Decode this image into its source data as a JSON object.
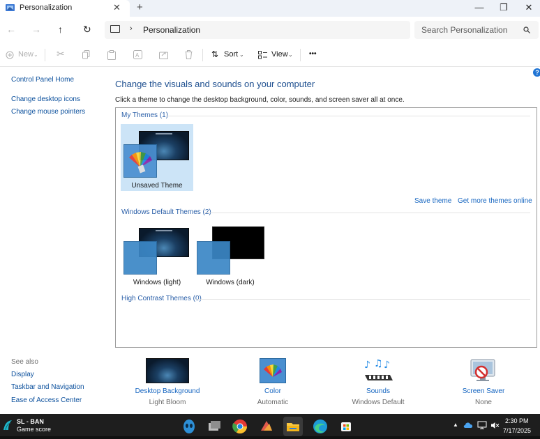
{
  "window": {
    "tab_title": "Personalization",
    "close_tab": "✕",
    "new_tab": "+",
    "minimize": "—",
    "maximize": "❐",
    "close": "✕"
  },
  "addressbar": {
    "back": "←",
    "forward": "→",
    "up": "↑",
    "refresh": "↻",
    "separator": "›",
    "breadcrumb": "Personalization",
    "search_placeholder": "Search Personalization"
  },
  "commandbar": {
    "new_label": "New",
    "sort_label": "Sort",
    "view_label": "View",
    "more_label": "•••"
  },
  "left_pane": {
    "links": [
      "Control Panel Home",
      "Change desktop icons",
      "Change mouse pointers"
    ],
    "see_also_title": "See also",
    "see_also": [
      "Display",
      "Taskbar and Navigation",
      "Ease of Access Center"
    ]
  },
  "main": {
    "help": "?",
    "title": "Change the visuals and sounds on your computer",
    "subtitle": "Click a theme to change the desktop background, color, sounds, and screen saver all at once.",
    "sections": {
      "my_themes": "My Themes (1)",
      "default_themes": "Windows Default Themes (2)",
      "high_contrast": "High Contrast Themes (0)"
    },
    "my_themes": [
      {
        "label": "Unsaved Theme"
      }
    ],
    "default_themes": [
      {
        "label": "Windows (light)"
      },
      {
        "label": "Windows (dark)"
      }
    ],
    "save_theme": "Save theme",
    "get_more": "Get more themes online"
  },
  "settings": [
    {
      "label": "Desktop Background",
      "value": "Light Bloom",
      "icon": "desktop-background-icon"
    },
    {
      "label": "Color",
      "value": "Automatic",
      "icon": "color-icon"
    },
    {
      "label": "Sounds",
      "value": "Windows Default",
      "icon": "sounds-icon"
    },
    {
      "label": "Screen Saver",
      "value": "None",
      "icon": "screen-saver-icon"
    }
  ],
  "taskbar": {
    "game_title": "SL - BAN",
    "game_subtitle": "Game score",
    "time": "2:30 PM",
    "date": "7/17/2025"
  },
  "colors": {
    "link": "#1565c0",
    "title": "#1e4f8f",
    "selection": "#cce4f7",
    "taskbar": "#1e1e1e"
  }
}
